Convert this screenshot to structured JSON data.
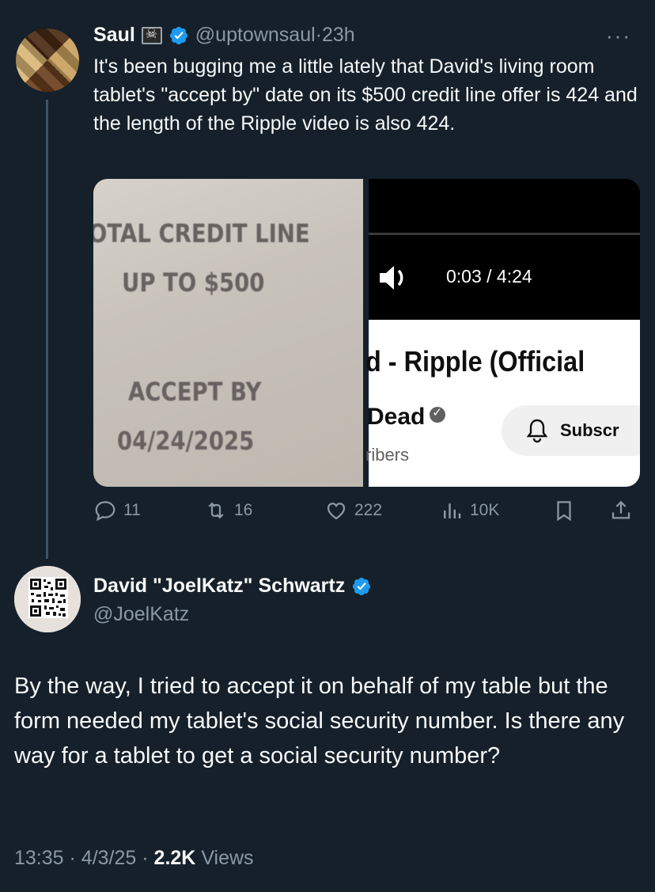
{
  "parent_tweet": {
    "author_name": "Saul",
    "handle": "@uptownsaul",
    "separator": "·",
    "time": "23h",
    "more": "···",
    "text": "It's been bugging me a little lately that David's living room tablet's \"accept by\" date on its $500 credit line offer is 424 and the length of the Ripple video is also 424.",
    "media": {
      "left_image": {
        "line1": "OTAL CREDIT LINE",
        "line2": "UP TO $500",
        "line3": "ACCEPT BY",
        "line4": "04/24/2025"
      },
      "right_image": {
        "timecode": "0:03 / 4:24",
        "title": "d - Ripple (Official",
        "channel": "Dead",
        "subscribers": "ribers",
        "subscribe": "Subscr"
      }
    },
    "actions": {
      "replies": "11",
      "reposts": "16",
      "likes": "222",
      "views": "10K"
    }
  },
  "reply": {
    "author_name": "David \"JoelKatz\" Schwartz",
    "handle": "@JoelKatz",
    "text": "By the way, I tried to accept it on behalf of my table but the form needed my tablet's social security number. Is there any way for a tablet to get a social security number?",
    "time": "13:35",
    "separator1": "·",
    "date": "4/3/25",
    "separator2": "·",
    "views_count": "2.2K",
    "views_label": "Views"
  },
  "colors": {
    "background": "#15202b",
    "text": "#f7f9f9",
    "secondary": "#8b98a5",
    "verified": "#1d9bf0"
  },
  "icons": [
    "flag-icon",
    "verified-icon",
    "more-icon",
    "speaker-icon",
    "bell-icon",
    "reply-icon",
    "repost-icon",
    "like-icon",
    "views-icon",
    "bookmark-icon",
    "share-icon"
  ]
}
